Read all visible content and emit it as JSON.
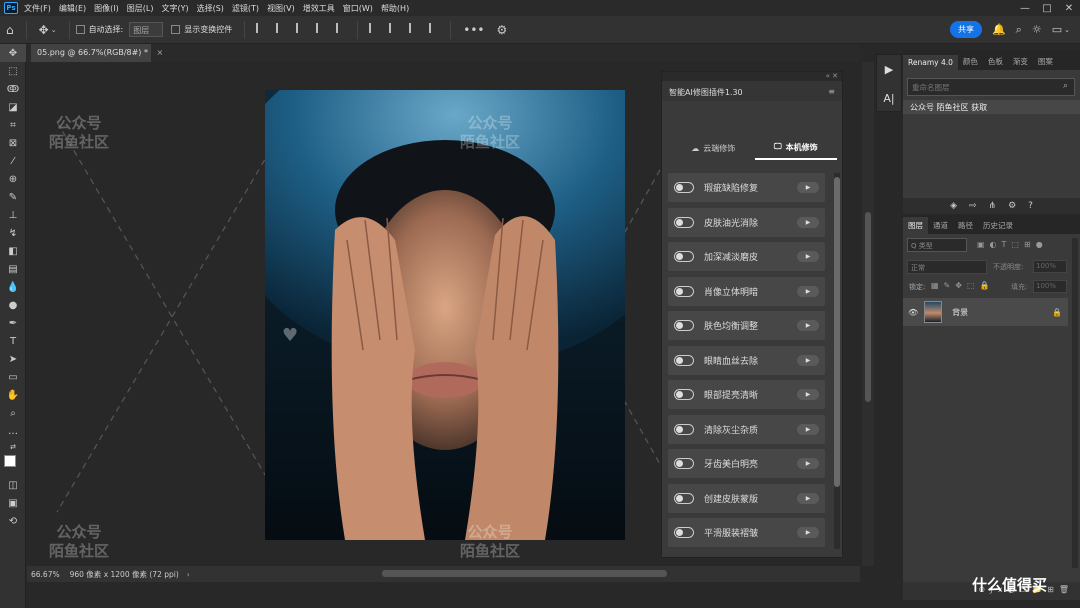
{
  "menu": {
    "logo": "Ps",
    "items": [
      "文件(F)",
      "编辑(E)",
      "图像(I)",
      "图层(L)",
      "文字(Y)",
      "选择(S)",
      "滤镜(T)",
      "视图(V)",
      "增效工具",
      "窗口(W)",
      "帮助(H)"
    ],
    "window_controls": [
      "—",
      "□",
      "✕"
    ]
  },
  "options": {
    "auto_select_label": "自动选择:",
    "auto_select_value": "图层",
    "show_transform_label": "显示变换控件",
    "share_label": "共享",
    "more": "•••"
  },
  "document": {
    "tab_label": "05.png @ 66.7%(RGB/8#) *",
    "tab_close": "×"
  },
  "plugin": {
    "header_icons": "« ✕",
    "title": "智能AI修图插件1.30",
    "menu_icon": "≡",
    "tab_cloud": "云端修饰",
    "tab_local": "本机修饰",
    "items": [
      "瑕疵缺陷修复",
      "皮肤油光消除",
      "加深减淡磨皮",
      "肖像立体明暗",
      "肤色均衡调整",
      "眼睛血丝去除",
      "眼部提亮清晰",
      "清除灰尘杂质",
      "牙齿美白明亮",
      "创建皮肤蒙版",
      "平滑服装褶皱"
    ],
    "play_glyph": "▶"
  },
  "side_buttons": {
    "play": "▶",
    "text": "A|"
  },
  "renamy": {
    "tabs": [
      "Renamy 4.0",
      "颜色",
      "色板",
      "渐变",
      "图案"
    ],
    "search_placeholder": "重命名图层",
    "item_label": "公众号  陌鱼社区 获取"
  },
  "layers": {
    "tabs": [
      "图层",
      "通道",
      "路径",
      "历史记录"
    ],
    "filter_label": "Q 类型",
    "blend_mode": "正常",
    "opacity_label": "不透明度:",
    "opacity_value": "100%",
    "lock_label": "锁定:",
    "fill_label": "填充:",
    "fill_value": "100%",
    "layer_name": "背景",
    "eye": "👁",
    "lock": "🔒"
  },
  "status": {
    "zoom": "66.67%",
    "doc_info": "960 像素 x 1200 像素 (72 ppi)"
  },
  "watermark": {
    "line1": "公众号",
    "line2": "陌鱼社区",
    "bottom_brand": "什么值得买"
  }
}
